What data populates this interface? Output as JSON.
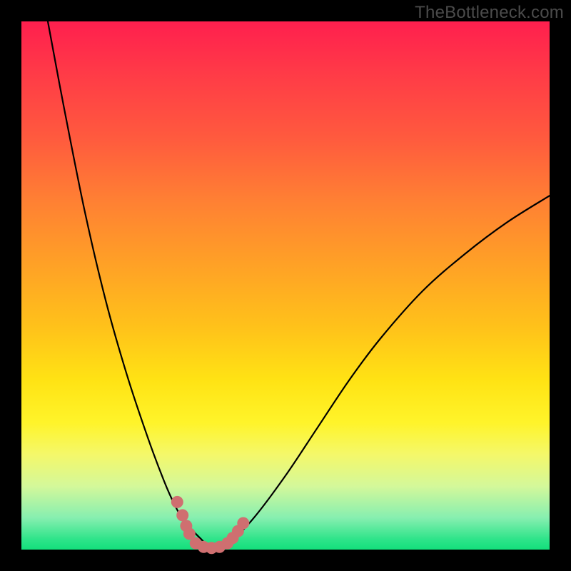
{
  "watermark": "TheBottleneck.com",
  "colors": {
    "background": "#000000",
    "gradient_top": "#ff1f4e",
    "gradient_bottom": "#13df7c",
    "curve": "#000000",
    "marker": "#cf6f70"
  },
  "chart_data": {
    "type": "line",
    "title": "",
    "xlabel": "",
    "ylabel": "",
    "xlim": [
      0,
      100
    ],
    "ylim": [
      0,
      100
    ],
    "grid": false,
    "series": [
      {
        "name": "left-falling-curve",
        "x": [
          5,
          8,
          12,
          16,
          20,
          24,
          27,
          29,
          31,
          33,
          34.5,
          36
        ],
        "values": [
          100,
          84,
          64,
          47,
          33,
          21,
          13,
          8.5,
          5,
          3,
          1.5,
          0
        ]
      },
      {
        "name": "right-rising-curve",
        "x": [
          36,
          40,
          44,
          50,
          56,
          62,
          68,
          76,
          84,
          92,
          100
        ],
        "values": [
          0,
          2,
          6,
          14,
          23,
          32,
          40,
          49,
          56,
          62,
          67
        ]
      }
    ],
    "markers": [
      {
        "x": 29.5,
        "y": 9
      },
      {
        "x": 30.5,
        "y": 6.5
      },
      {
        "x": 31.2,
        "y": 4.5
      },
      {
        "x": 31.8,
        "y": 3
      },
      {
        "x": 33,
        "y": 1.2
      },
      {
        "x": 34.5,
        "y": 0.5
      },
      {
        "x": 36,
        "y": 0.3
      },
      {
        "x": 37.5,
        "y": 0.5
      },
      {
        "x": 39,
        "y": 1.2
      },
      {
        "x": 40,
        "y": 2.2
      },
      {
        "x": 41,
        "y": 3.5
      },
      {
        "x": 42,
        "y": 5
      }
    ],
    "annotations": []
  }
}
